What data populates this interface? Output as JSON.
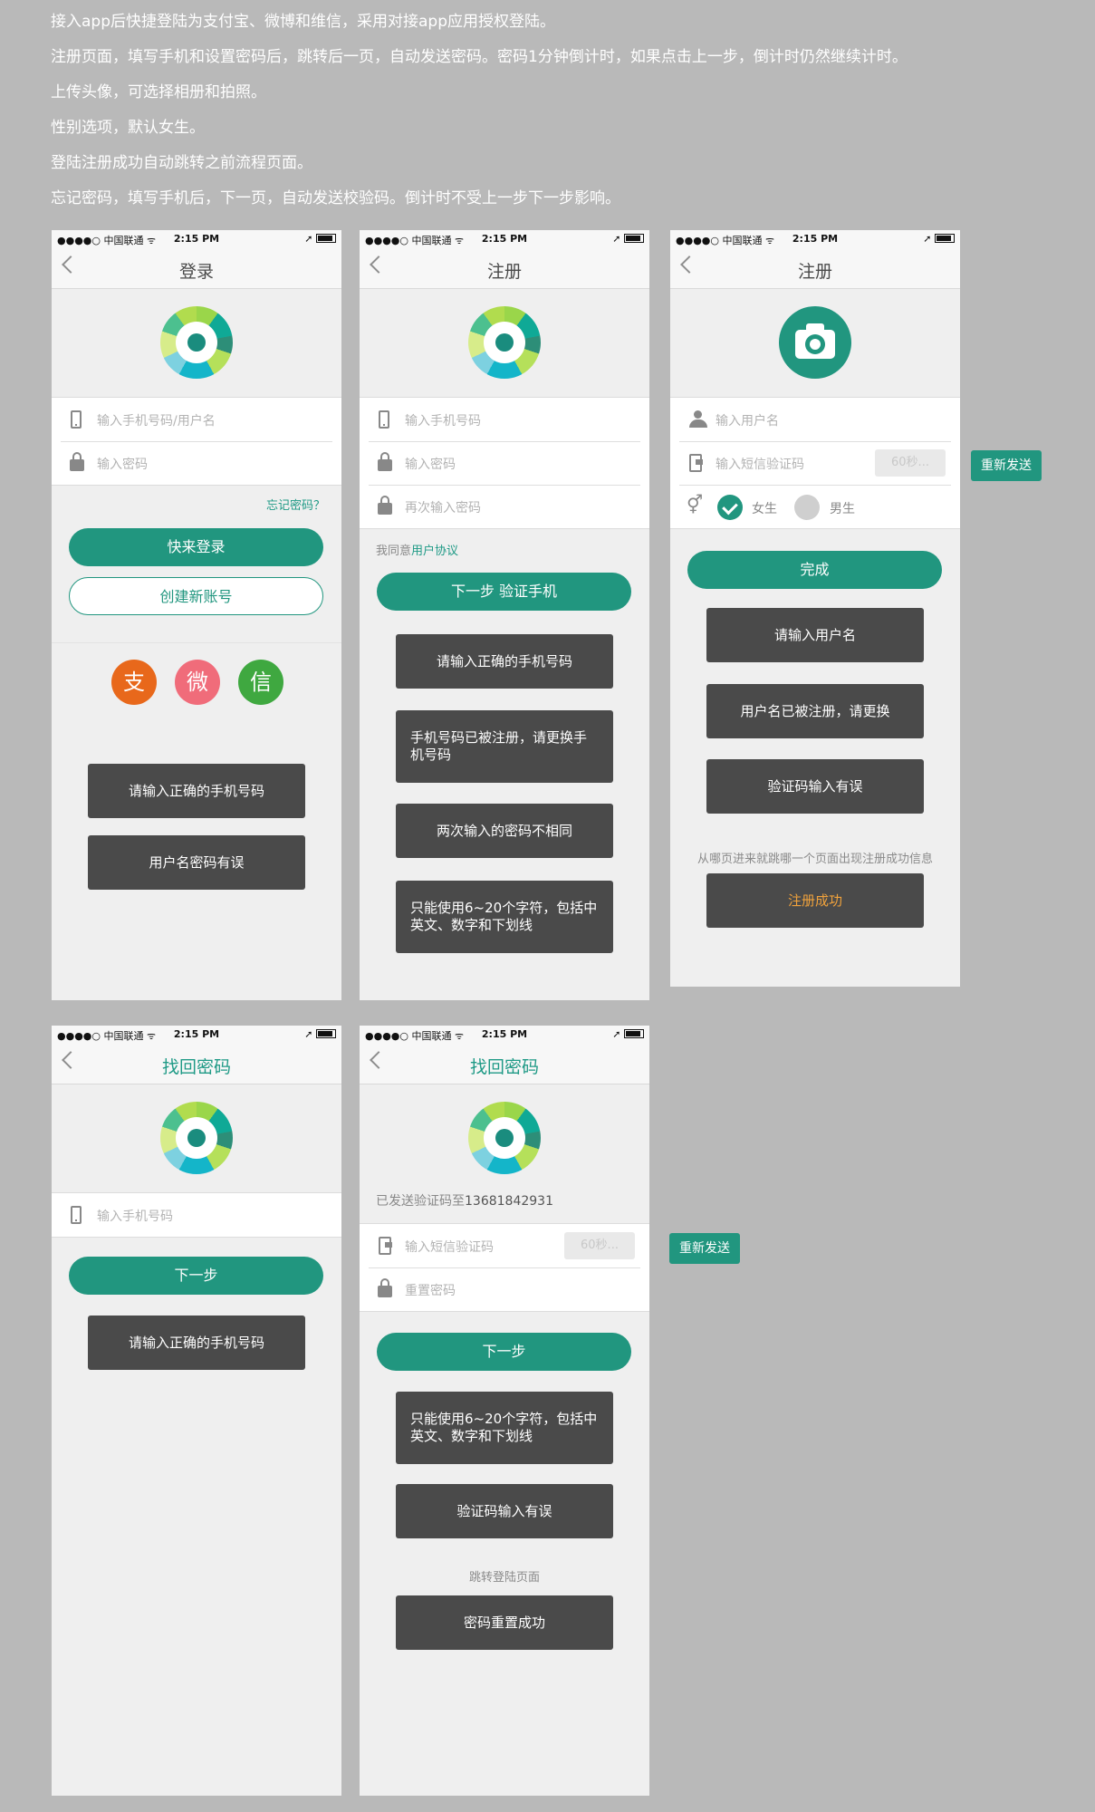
{
  "notes": [
    "接入app后快捷登陆为支付宝、微博和维信，采用对接app应用授权登陆。",
    "注册页面，填写手机和设置密码后，跳转后一页，自动发送密码。密码1分钟倒计时，如果点击上一步，倒计时仍然继续计时。",
    "上传头像，可选择相册和拍照。",
    "性别选项，默认女生。",
    "登陆注册成功自动跳转之前流程页面。",
    "忘记密码，填写手机后，下一页，自动发送校验码。倒计时不受上一步下一步影响。"
  ],
  "status": {
    "carrier": "●●●●○ 中国联通 ᯤ",
    "time": "2:15 PM",
    "right": "➚"
  },
  "login": {
    "title": "登录",
    "phone_placeholder": "输入手机号码/用户名",
    "password_placeholder": "输入密码",
    "forgot": "忘记密码？",
    "login_button": "快来登录",
    "create_button": "创建新账号",
    "social": {
      "alipay": "支",
      "weibo": "微",
      "wechat": "信"
    },
    "toasts": [
      "请输入正确的手机号码",
      "用户名密码有误"
    ]
  },
  "register1": {
    "title": "注册",
    "phone_placeholder": "输入手机号码",
    "password_placeholder": "输入密码",
    "repeat_placeholder": "再次输入密码",
    "agree_prefix": "我同意",
    "agree_link": "用户协议",
    "next_button": "下一步 验证手机",
    "toasts": [
      "请输入正确的手机号码",
      "手机号码已被注册，请更换手机号码",
      "两次输入的密码不相同",
      "只能使用6~20个字符，包括中英文、数字和下划线"
    ]
  },
  "register2": {
    "title": "注册",
    "username_placeholder": "输入用户名",
    "sms_placeholder": "输入短信验证码",
    "countdown": "60秒...",
    "female": "女生",
    "male": "男生",
    "done_button": "完成",
    "toasts": [
      "请输入用户名",
      "用户名已被注册，请更换",
      "验证码输入有误"
    ],
    "hint": "从哪页进来就跳哪一个页面出现注册成功信息",
    "success_toast": "注册成功",
    "resend": "重新发送"
  },
  "forgot1": {
    "title": "找回密码",
    "phone_placeholder": "输入手机号码",
    "next_button": "下一步",
    "toast": "请输入正确的手机号码"
  },
  "forgot2": {
    "title": "找回密码",
    "sent_prefix": "已发送验证码至",
    "sent_number": "13681842931",
    "sms_placeholder": "输入短信验证码",
    "countdown": "60秒...",
    "reset_placeholder": "重置密码",
    "next_button": "下一步",
    "toasts": [
      "只能使用6~20个字符，包括中英文、数字和下划线",
      "验证码输入有误"
    ],
    "hint": "跳转登陆页面",
    "success_toast": "密码重置成功",
    "resend": "重新发送"
  },
  "colors": {
    "background": "#b9b9b9",
    "accent": "#21967f",
    "toast": "#4a4a4a",
    "success_text": "#f0a23c",
    "alipay": "#e8681b",
    "weibo": "#f06c7a",
    "wechat": "#3fa840"
  }
}
